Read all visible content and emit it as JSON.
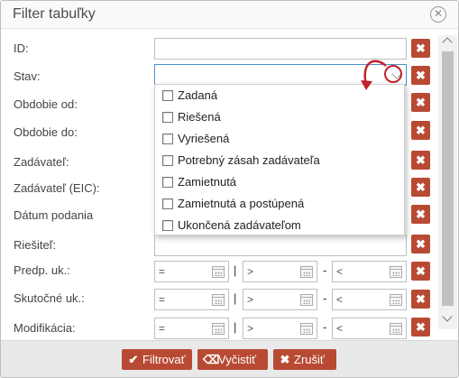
{
  "dialog": {
    "title": "Filter tabuľky",
    "close_icon": "circle-x-icon"
  },
  "fields": {
    "id_label": "ID:",
    "stav_label": "Stav:",
    "obdobie_od_label": "Obdobie od:",
    "obdobie_do_label": "Obdobie do:",
    "zadavatel_label": "Zadávateľ:",
    "zadavatel_eic_label": "Zadávateľ (EIC):",
    "datum_podania_label": "Dátum podania",
    "riesitel_label": "Riešiteľ:",
    "predp_uk_label": "Predp. uk.:",
    "skutocne_uk_label": "Skutočné uk.:",
    "modifikacia_label": "Modifikácia:"
  },
  "clear_button_glyph": "✖",
  "date_range": {
    "eq_prefix": "=",
    "gt_prefix": ">",
    "lt_prefix": "<",
    "separator_or": "|",
    "separator_dash": "-"
  },
  "stav_dropdown": {
    "options": [
      {
        "label": "Zadaná",
        "checked": false
      },
      {
        "label": "Riešená",
        "checked": false
      },
      {
        "label": "Vyriešená",
        "checked": false
      },
      {
        "label": "Potrebný zásah zadávateľa",
        "checked": false
      },
      {
        "label": "Zamietnutá",
        "checked": false
      },
      {
        "label": "Zamietnutá a postúpená",
        "checked": false
      },
      {
        "label": "Ukončená zadávateľom",
        "checked": false
      }
    ]
  },
  "footer": {
    "filter_label": "Filtrovať",
    "clear_label": "Vyčistiť",
    "cancel_label": "Zrušiť"
  },
  "colors": {
    "accent": "#b84a33",
    "annotation": "#c0222a",
    "focus_border": "#4a90c8"
  }
}
